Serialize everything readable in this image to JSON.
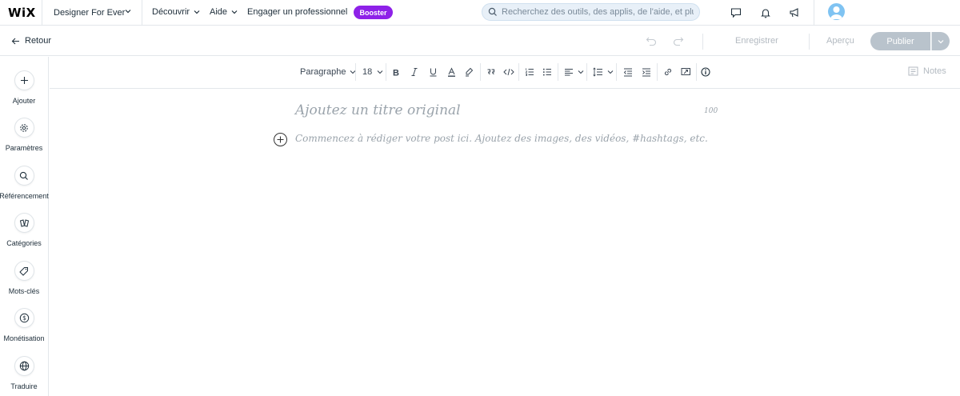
{
  "topbar": {
    "logo": "WiX",
    "site_name": "Designer For Ever",
    "nav": [
      "Découvrir",
      "Aide",
      "Engager un professionnel"
    ],
    "booster_label": "Booster",
    "search_placeholder": "Recherchez des outils, des applis, de l'aide, et plus...",
    "icons": [
      "chat-icon",
      "bell-icon",
      "megaphone-icon"
    ]
  },
  "subbar": {
    "back_label": "Retour",
    "save_label": "Enregistrer",
    "preview_label": "Aperçu",
    "publish_label": "Publier"
  },
  "sidebar": {
    "items": [
      {
        "label": "Ajouter",
        "icon": "plus-icon"
      },
      {
        "label": "Paramètres",
        "icon": "gear-icon"
      },
      {
        "label": "Référencement",
        "icon": "search-icon"
      },
      {
        "label": "Catégories",
        "icon": "categories-icon"
      },
      {
        "label": "Mots-clés",
        "icon": "tag-icon"
      },
      {
        "label": "Monétisation",
        "icon": "dollar-icon"
      },
      {
        "label": "Traduire",
        "icon": "globe-icon"
      }
    ]
  },
  "toolbar": {
    "paragraph_label": "Paragraphe",
    "font_size": "18",
    "notes_label": "Notes"
  },
  "editor": {
    "title_placeholder": "Ajoutez un titre original",
    "title_counter": "100",
    "body_placeholder": "Commencez à rédiger votre post ici. Ajoutez des images, des vidéos, #hashtags, etc."
  },
  "colors": {
    "booster": "#8e21e8",
    "search_bg": "#e8f0f8",
    "publish_bg": "#b9c3cc",
    "avatar": "#7fc3f2"
  }
}
